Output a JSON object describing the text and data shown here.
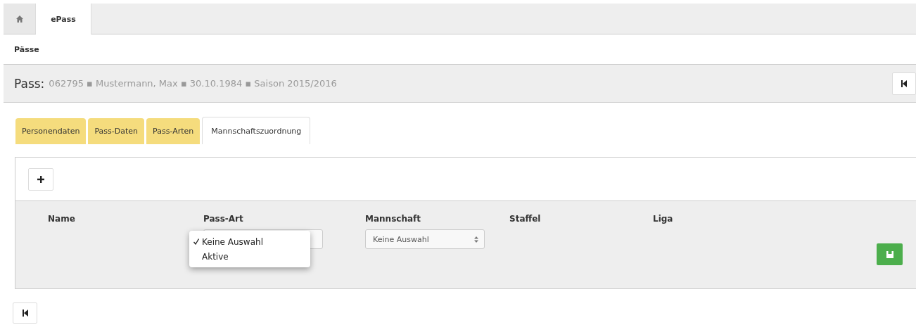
{
  "nav_tabs": [
    {
      "kind": "home",
      "selected": false
    },
    {
      "kind": "text",
      "label": "ePass",
      "selected": true
    }
  ],
  "breadcrumb": "Pässe",
  "header": {
    "label": "Pass:",
    "details": "062795 ▪ Mustermann, Max ▪ 30.10.1984 ▪ Saison 2015/2016"
  },
  "tabs": [
    {
      "label": "Personendaten",
      "selected": false
    },
    {
      "label": "Pass-Daten",
      "selected": false
    },
    {
      "label": "Pass-Arten",
      "selected": false
    },
    {
      "label": "Mannschaftszuordnung",
      "selected": true
    }
  ],
  "table": {
    "columns": [
      "Name",
      "Pass-Art",
      "Mannschaft",
      "Staffel",
      "Liga"
    ],
    "pass_art_menu": [
      {
        "label": "Keine Auswahl",
        "selected": true
      },
      {
        "label": "Aktive",
        "selected": false
      }
    ],
    "mannschaft_value": "Keine Auswahl"
  }
}
